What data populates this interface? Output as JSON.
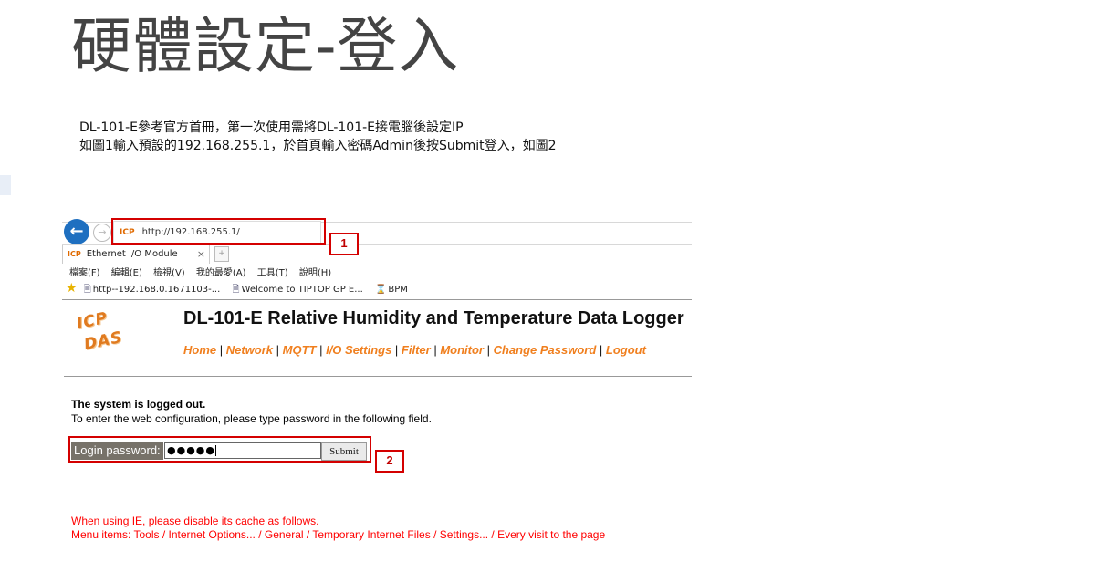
{
  "slide": {
    "title": "硬體設定-登入",
    "line1": "DL-101-E參考官方首冊，第一次使用需將DL-101-E接電腦後設定IP",
    "line2": "如圖1輸入預設的192.168.255.1，於首頁輸入密碼Admin後按Submit登入，如圖2"
  },
  "browser": {
    "back_icon": "back-arrow-icon",
    "forward_icon": "forward-arrow-icon",
    "url": "http://192.168.255.1/",
    "tab_title": "Ethernet I/O Module",
    "tab_close": "×",
    "menu": [
      "檔案(F)",
      "編輯(E)",
      "檢視(V)",
      "我的最愛(A)",
      "工具(T)",
      "說明(H)"
    ],
    "favorites": [
      "http--192.168.0.1671103-...",
      "Welcome to TIPTOP GP E...",
      "BPM"
    ]
  },
  "page": {
    "logo_line1": "ICP",
    "logo_line2": "DAS",
    "title": "DL-101-E Relative Humidity and Temperature Data Logger",
    "nav": [
      "Home",
      "Network",
      "MQTT",
      "I/O Settings",
      "Filter",
      "Monitor",
      "Change Password",
      "Logout"
    ],
    "nav_separator": " | ",
    "status_title": "The system is logged out.",
    "status_text": "To enter the web configuration, please type password in the following field.",
    "login_label": "Login password:",
    "password_mask": "●●●●●",
    "submit_label": "Submit",
    "note1": "When using IE, please disable its cache as follows.",
    "note2": "Menu items: Tools / Internet Options... / General / Temporary Internet Files / Settings... / Every visit to the page"
  },
  "annotations": {
    "box1_label": "1",
    "box2_label": "2"
  },
  "colors": {
    "link": "#f07f1e",
    "annotation": "#d40000",
    "note": "#ff0000",
    "login_label_bg": "#777269"
  }
}
